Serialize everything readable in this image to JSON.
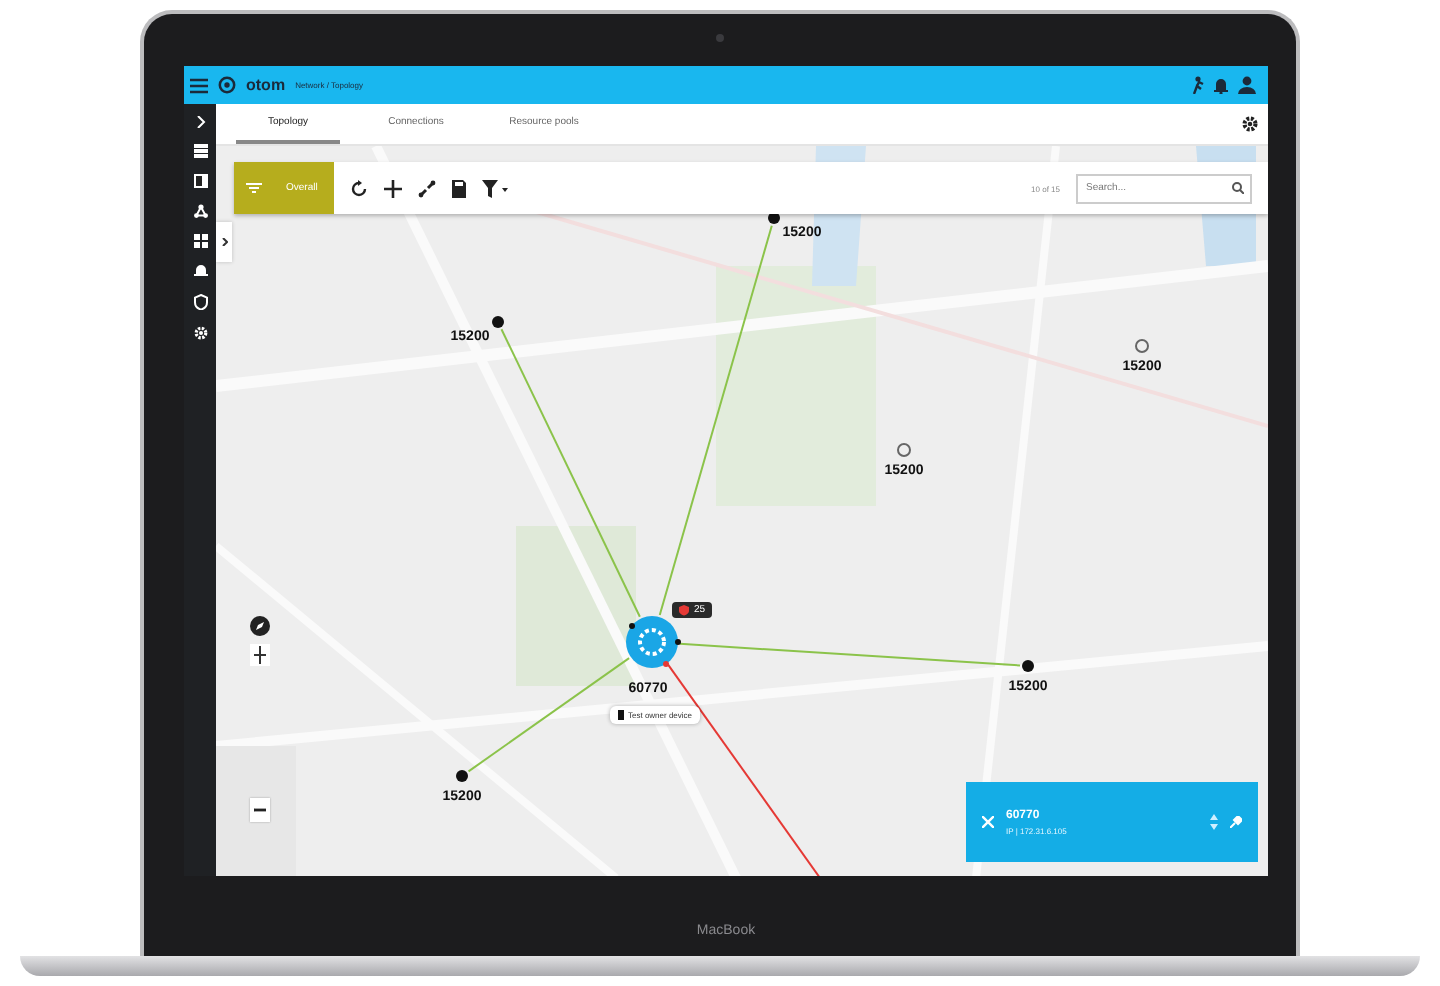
{
  "app": {
    "name": "otom",
    "breadcrumb": "Network / Topology"
  },
  "tabs": [
    {
      "label": "Topology",
      "selected": true
    },
    {
      "label": "Connections",
      "selected": false
    },
    {
      "label": "Resource pools",
      "selected": false
    }
  ],
  "toolbar": {
    "overall": "Overall",
    "count": "10 of 15",
    "search": {
      "placeholder": "Search..."
    }
  },
  "hub": {
    "label": "60770",
    "badge": "25",
    "tooltip": "Test owner device"
  },
  "nodes": [
    {
      "label": "15200",
      "kind": "solid"
    },
    {
      "label": "15200",
      "kind": "solid"
    },
    {
      "label": "15200",
      "kind": "hollow"
    },
    {
      "label": "15200",
      "kind": "hollow"
    },
    {
      "label": "15200",
      "kind": "solid"
    },
    {
      "label": "15200",
      "kind": "solid"
    }
  ],
  "links": [
    {
      "color": "#8bc34a"
    },
    {
      "color": "#8bc34a"
    },
    {
      "color": "#8bc34a"
    },
    {
      "color": "#8bc34a"
    },
    {
      "color": "#e53935"
    }
  ],
  "panel": {
    "title": "60770",
    "subtitle": "IP | 172.31.6.105"
  },
  "device": {
    "brand": "MacBook"
  }
}
